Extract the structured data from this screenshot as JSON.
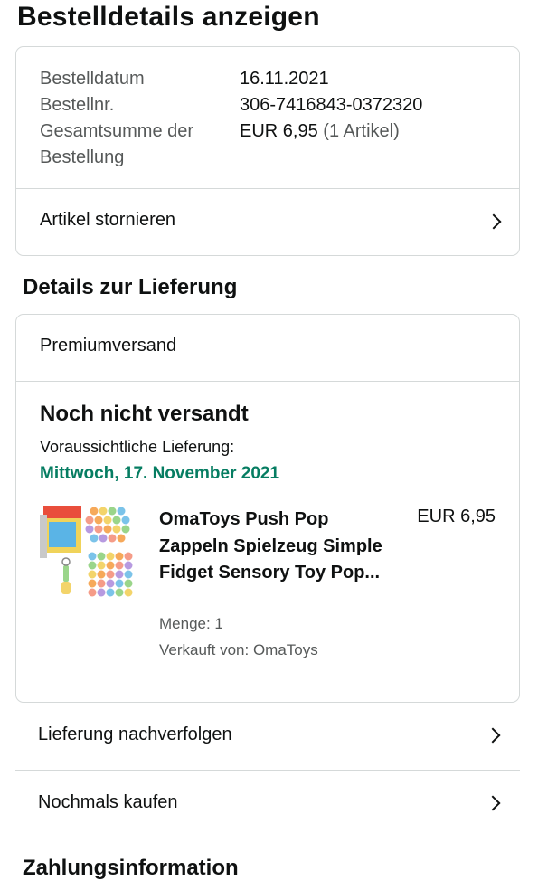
{
  "page": {
    "title": "Bestelldetails anzeigen"
  },
  "order_summary": {
    "rows": [
      {
        "label": "Bestelldatum",
        "value": "16.11.2021"
      },
      {
        "label": "Bestellnr.",
        "value": "306-7416843-0372320"
      },
      {
        "label": "Gesamtsumme der Bestellung",
        "value": "EUR 6,95",
        "value_suffix": "(1 Artikel)"
      }
    ],
    "cancel_label": "Artikel stornieren"
  },
  "delivery": {
    "section_title": "Details zur Lieferung",
    "shipping_method": "Premiumversand",
    "status": "Noch nicht versandt",
    "expected_label": "Voraussichtliche Lieferung:",
    "expected_date": "Mittwoch, 17. November 2021",
    "product": {
      "title": "OmaToys Push Pop Zappeln Spielzeug Simple Fidget Sensory Toy Pop...",
      "price": "EUR 6,95",
      "quantity": "Menge: 1",
      "seller": "Verkauft von: OmaToys",
      "thumbnail_icon": "product-thumbnail-icon"
    }
  },
  "actions": {
    "track_label": "Lieferung nachverfolgen",
    "buy_again_label": "Nochmals kaufen"
  },
  "payment": {
    "section_title": "Zahlungsinformation"
  },
  "colors": {
    "delivery_date": "#067d62",
    "border": "#d5d9d9",
    "text": "#0f1111",
    "muted": "#565959"
  }
}
